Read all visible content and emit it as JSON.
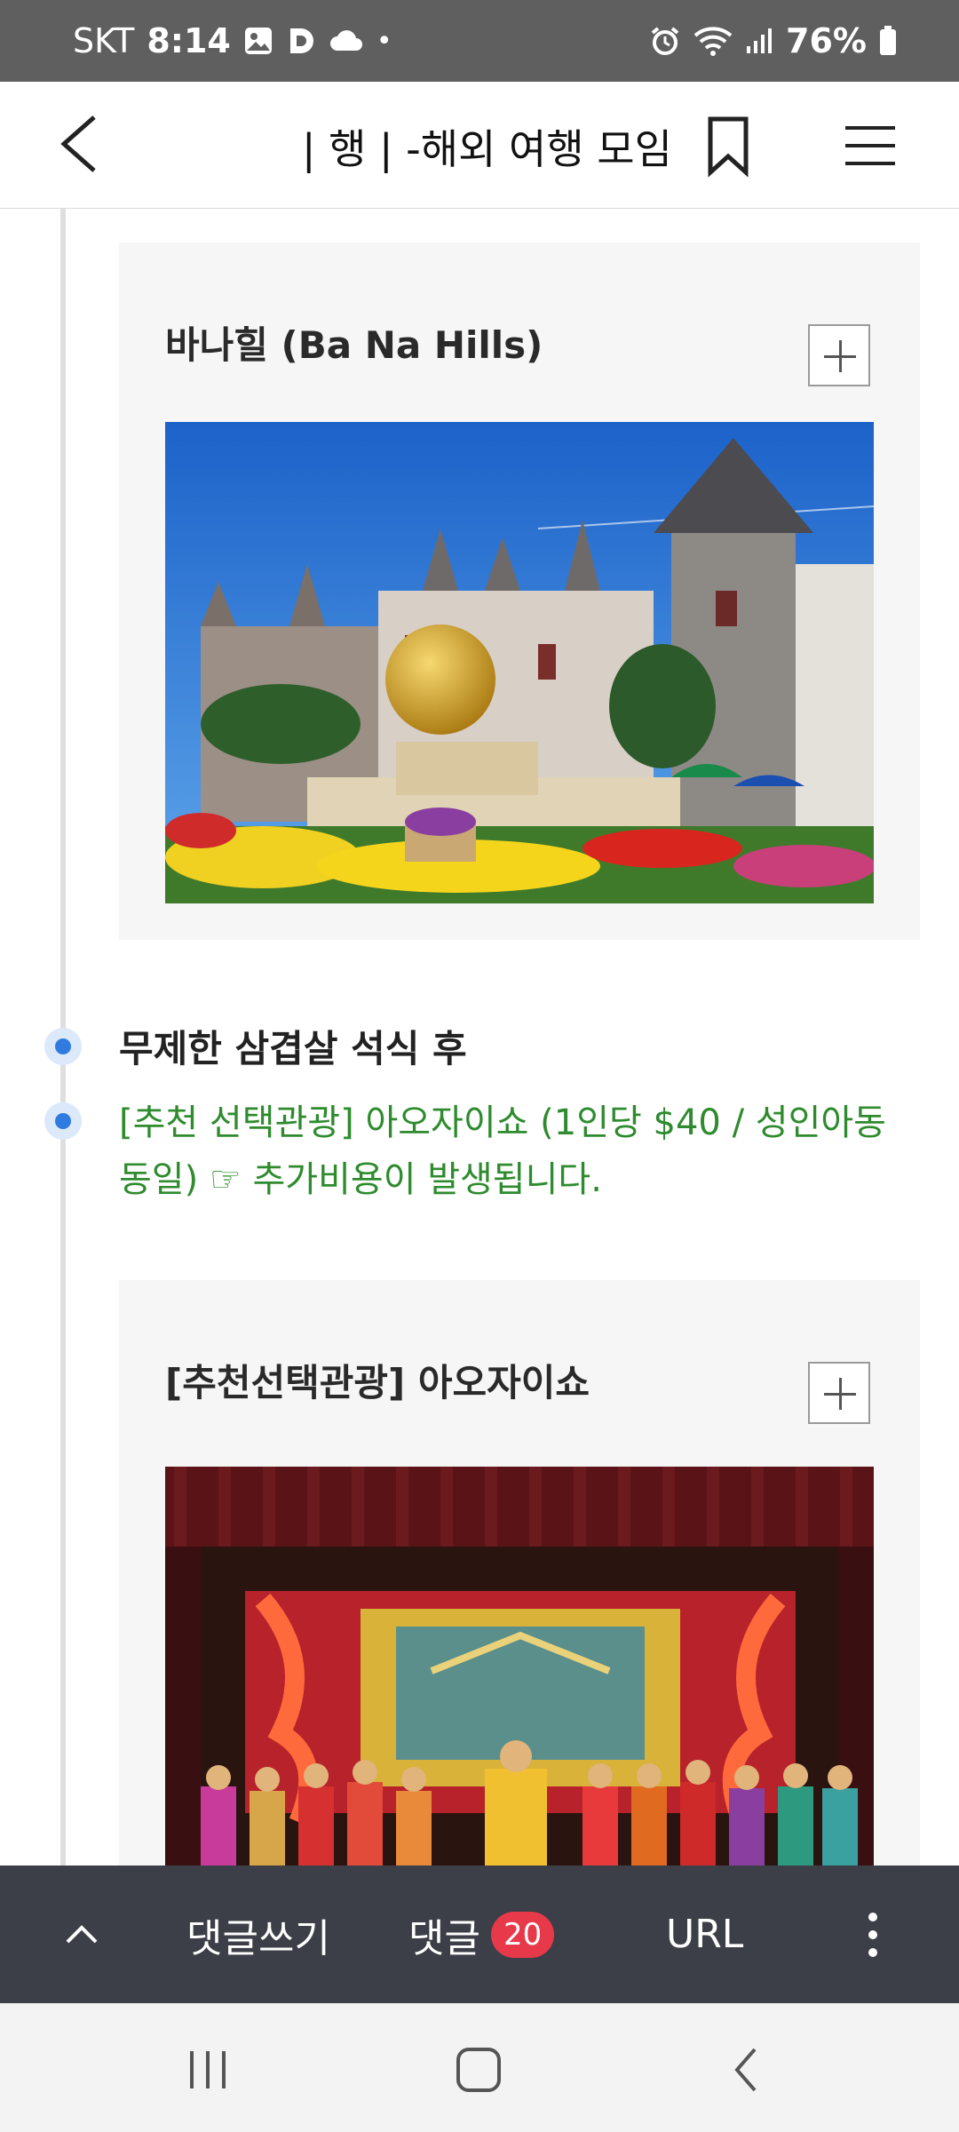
{
  "status_bar": {
    "carrier": "SKT",
    "time": "8:14",
    "dot": "•",
    "battery": "76%"
  },
  "header": {
    "title": "| 행 | -해외 여행 모임"
  },
  "sections": {
    "card1_title": "바나힐 (Ba Na Hills)",
    "item1": "무제한 삼겹살 석식 후",
    "item2_line1": "[추천 선택관광] 아오자이쇼 (1인당 $40 / 성인아동",
    "item2_line2": "동일) ☞ 추가비용이 발생됩니다.",
    "card2_title": "[추천선택관광] 아오자이쇼"
  },
  "bottom_bar": {
    "write_comment": "댓글쓰기",
    "comments_label": "댓글",
    "comments_count": "20",
    "url_label": "URL"
  },
  "colors": {
    "accent_green": "#2e8b2e",
    "timeline_dot": "#2f7be0",
    "badge_red": "#e8394a",
    "bottom_bar_bg": "#3c3f47"
  },
  "icons": [
    "image-icon",
    "d-app-icon",
    "cloud-icon",
    "alarm-icon",
    "wifi-icon",
    "signal-icon",
    "battery-icon",
    "back-arrow-icon",
    "bookmark-icon",
    "menu-icon",
    "plus-icon",
    "chevron-up-icon",
    "more-vert-icon",
    "recent-apps-icon",
    "home-icon",
    "nav-back-icon"
  ]
}
